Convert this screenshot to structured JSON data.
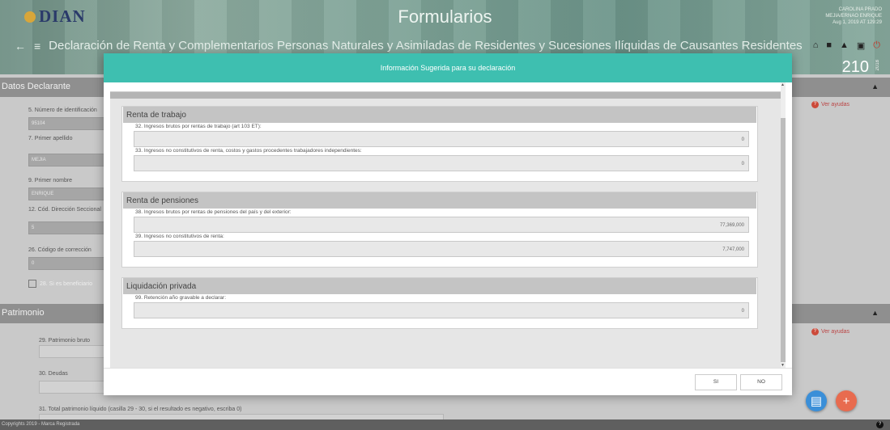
{
  "header": {
    "logo_text": "DIAN",
    "app_title": "Formularios",
    "form_name": "Declaración de Renta y Complementarios Personas Naturales y Asimiladas de Residentes y Sucesiones Ilíquidas de Causantes Residentes",
    "form_number": "210",
    "form_year": "2018",
    "user_lines": [
      "CAROLINA PRADO",
      "MEJIA/ERNAO ENRIQUE",
      "Aug 1, 2019 AT 129:29"
    ],
    "top_icons": [
      "home-icon",
      "folder-icon",
      "bell-icon",
      "calendar-icon",
      "power-icon"
    ]
  },
  "background": {
    "section_datos": "Datos Declarante",
    "section_patrimonio": "Patrimonio",
    "fields": [
      {
        "label": "5. Número de identificación",
        "value": "95104"
      },
      {
        "label": "7. Primer apellido",
        "value": "MEJIA"
      },
      {
        "label": "9. Primer nombre",
        "value": "ENRIQUE"
      },
      {
        "label": "12. Cód. Dirección Seccional",
        "value": "5"
      },
      {
        "label": "26. Código de corrección",
        "value": "0"
      }
    ],
    "checkbox_label": "28. Si es beneficiario",
    "patrimonio_fields": [
      {
        "label": "29. Patrimonio bruto"
      },
      {
        "label": "30. Deudas"
      }
    ],
    "patrimonio_total_label": "31. Total patrimonio líquido (casilla 29 - 30, si el resultado es negativo, escriba 0)",
    "help_link": "Ver ayudas",
    "footer_text": "Copyrights 2019 - Marca Registrada"
  },
  "modal": {
    "title": "Información Sugerida para su declaración",
    "sections": [
      {
        "title": "Renta de trabajo",
        "fields": [
          {
            "label": "32. Ingresos brutos por rentas de trabajo (art 103 ET):",
            "value": "0"
          },
          {
            "label": "33. Ingresos no constitutivos de renta, costos y gastos procedentes trabajadores independientes:",
            "value": "0"
          }
        ]
      },
      {
        "title": "Renta de pensiones",
        "fields": [
          {
            "label": "38. Ingresos brutos por rentas de pensiones del país y del exterior:",
            "value": "77,369,000"
          },
          {
            "label": "39. Ingresos no constitutivos de renta:",
            "value": "7,747,000"
          }
        ]
      },
      {
        "title": "Liquidación privada",
        "fields": [
          {
            "label": "99. Retención año gravable a declarar:",
            "value": "0"
          }
        ]
      }
    ],
    "btn_yes": "SI",
    "btn_no": "NO"
  },
  "colors": {
    "modal_header": "#3ebfb0",
    "fab_doc": "#3b8fd8",
    "fab_add": "#e86b4f"
  }
}
